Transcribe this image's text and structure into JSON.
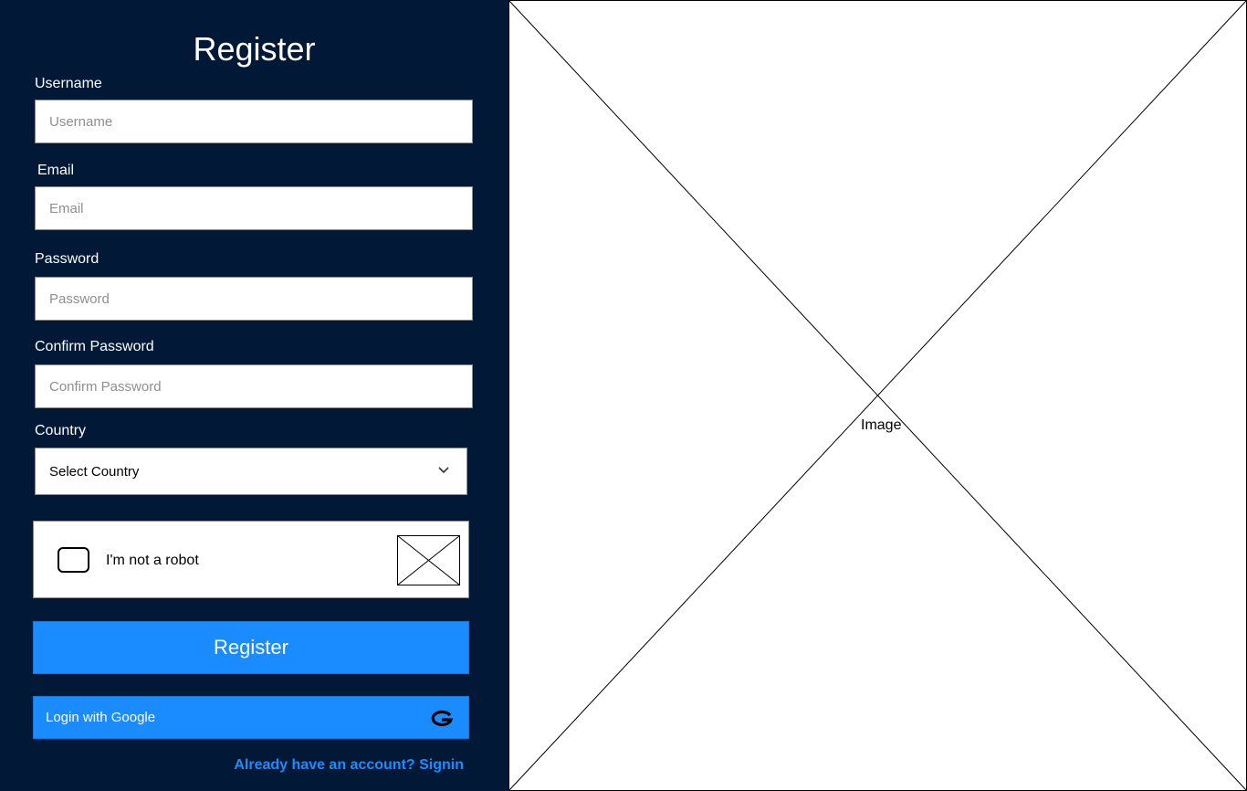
{
  "form": {
    "title": "Register",
    "username": {
      "label": "Username",
      "placeholder": "Username"
    },
    "email": {
      "label": "Email",
      "placeholder": "Email"
    },
    "password": {
      "label": "Password",
      "placeholder": "Password"
    },
    "confirm_password": {
      "label": "Confirm Password",
      "placeholder": "Confirm Password"
    },
    "country": {
      "label": "Country",
      "selected": "Select Country"
    },
    "captcha": {
      "label": "I'm not a robot"
    },
    "register_button": "Register",
    "google_button": "Login with Google",
    "signin_link": "Already have an account? Signin"
  },
  "image": {
    "label": "Image"
  },
  "colors": {
    "panel_background": "#011936",
    "accent": "#1a8cff",
    "link": "#1a8cff"
  },
  "icons": [
    "chevron-down-icon",
    "captcha-logo-icon",
    "google-icon"
  ]
}
